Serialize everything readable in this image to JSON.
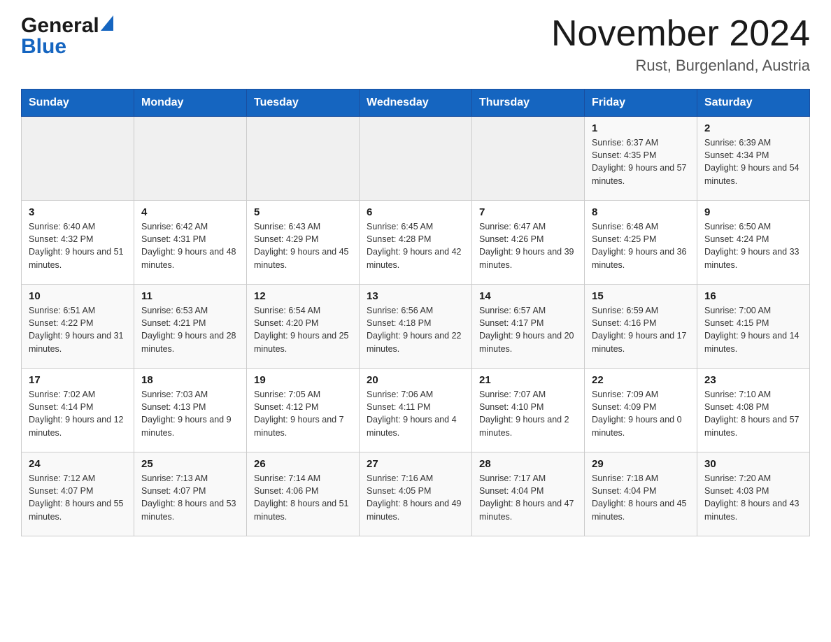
{
  "logo": {
    "general": "General",
    "blue": "Blue",
    "triangle_color": "#1565c0"
  },
  "header": {
    "title": "November 2024",
    "subtitle": "Rust, Burgenland, Austria"
  },
  "weekdays": [
    "Sunday",
    "Monday",
    "Tuesday",
    "Wednesday",
    "Thursday",
    "Friday",
    "Saturday"
  ],
  "weeks": [
    {
      "days": [
        {
          "number": "",
          "info": "",
          "empty": true
        },
        {
          "number": "",
          "info": "",
          "empty": true
        },
        {
          "number": "",
          "info": "",
          "empty": true
        },
        {
          "number": "",
          "info": "",
          "empty": true
        },
        {
          "number": "",
          "info": "",
          "empty": true
        },
        {
          "number": "1",
          "info": "Sunrise: 6:37 AM\nSunset: 4:35 PM\nDaylight: 9 hours and 57 minutes."
        },
        {
          "number": "2",
          "info": "Sunrise: 6:39 AM\nSunset: 4:34 PM\nDaylight: 9 hours and 54 minutes."
        }
      ]
    },
    {
      "days": [
        {
          "number": "3",
          "info": "Sunrise: 6:40 AM\nSunset: 4:32 PM\nDaylight: 9 hours and 51 minutes."
        },
        {
          "number": "4",
          "info": "Sunrise: 6:42 AM\nSunset: 4:31 PM\nDaylight: 9 hours and 48 minutes."
        },
        {
          "number": "5",
          "info": "Sunrise: 6:43 AM\nSunset: 4:29 PM\nDaylight: 9 hours and 45 minutes."
        },
        {
          "number": "6",
          "info": "Sunrise: 6:45 AM\nSunset: 4:28 PM\nDaylight: 9 hours and 42 minutes."
        },
        {
          "number": "7",
          "info": "Sunrise: 6:47 AM\nSunset: 4:26 PM\nDaylight: 9 hours and 39 minutes."
        },
        {
          "number": "8",
          "info": "Sunrise: 6:48 AM\nSunset: 4:25 PM\nDaylight: 9 hours and 36 minutes."
        },
        {
          "number": "9",
          "info": "Sunrise: 6:50 AM\nSunset: 4:24 PM\nDaylight: 9 hours and 33 minutes."
        }
      ]
    },
    {
      "days": [
        {
          "number": "10",
          "info": "Sunrise: 6:51 AM\nSunset: 4:22 PM\nDaylight: 9 hours and 31 minutes."
        },
        {
          "number": "11",
          "info": "Sunrise: 6:53 AM\nSunset: 4:21 PM\nDaylight: 9 hours and 28 minutes."
        },
        {
          "number": "12",
          "info": "Sunrise: 6:54 AM\nSunset: 4:20 PM\nDaylight: 9 hours and 25 minutes."
        },
        {
          "number": "13",
          "info": "Sunrise: 6:56 AM\nSunset: 4:18 PM\nDaylight: 9 hours and 22 minutes."
        },
        {
          "number": "14",
          "info": "Sunrise: 6:57 AM\nSunset: 4:17 PM\nDaylight: 9 hours and 20 minutes."
        },
        {
          "number": "15",
          "info": "Sunrise: 6:59 AM\nSunset: 4:16 PM\nDaylight: 9 hours and 17 minutes."
        },
        {
          "number": "16",
          "info": "Sunrise: 7:00 AM\nSunset: 4:15 PM\nDaylight: 9 hours and 14 minutes."
        }
      ]
    },
    {
      "days": [
        {
          "number": "17",
          "info": "Sunrise: 7:02 AM\nSunset: 4:14 PM\nDaylight: 9 hours and 12 minutes."
        },
        {
          "number": "18",
          "info": "Sunrise: 7:03 AM\nSunset: 4:13 PM\nDaylight: 9 hours and 9 minutes."
        },
        {
          "number": "19",
          "info": "Sunrise: 7:05 AM\nSunset: 4:12 PM\nDaylight: 9 hours and 7 minutes."
        },
        {
          "number": "20",
          "info": "Sunrise: 7:06 AM\nSunset: 4:11 PM\nDaylight: 9 hours and 4 minutes."
        },
        {
          "number": "21",
          "info": "Sunrise: 7:07 AM\nSunset: 4:10 PM\nDaylight: 9 hours and 2 minutes."
        },
        {
          "number": "22",
          "info": "Sunrise: 7:09 AM\nSunset: 4:09 PM\nDaylight: 9 hours and 0 minutes."
        },
        {
          "number": "23",
          "info": "Sunrise: 7:10 AM\nSunset: 4:08 PM\nDaylight: 8 hours and 57 minutes."
        }
      ]
    },
    {
      "days": [
        {
          "number": "24",
          "info": "Sunrise: 7:12 AM\nSunset: 4:07 PM\nDaylight: 8 hours and 55 minutes."
        },
        {
          "number": "25",
          "info": "Sunrise: 7:13 AM\nSunset: 4:07 PM\nDaylight: 8 hours and 53 minutes."
        },
        {
          "number": "26",
          "info": "Sunrise: 7:14 AM\nSunset: 4:06 PM\nDaylight: 8 hours and 51 minutes."
        },
        {
          "number": "27",
          "info": "Sunrise: 7:16 AM\nSunset: 4:05 PM\nDaylight: 8 hours and 49 minutes."
        },
        {
          "number": "28",
          "info": "Sunrise: 7:17 AM\nSunset: 4:04 PM\nDaylight: 8 hours and 47 minutes."
        },
        {
          "number": "29",
          "info": "Sunrise: 7:18 AM\nSunset: 4:04 PM\nDaylight: 8 hours and 45 minutes."
        },
        {
          "number": "30",
          "info": "Sunrise: 7:20 AM\nSunset: 4:03 PM\nDaylight: 8 hours and 43 minutes."
        }
      ]
    }
  ]
}
